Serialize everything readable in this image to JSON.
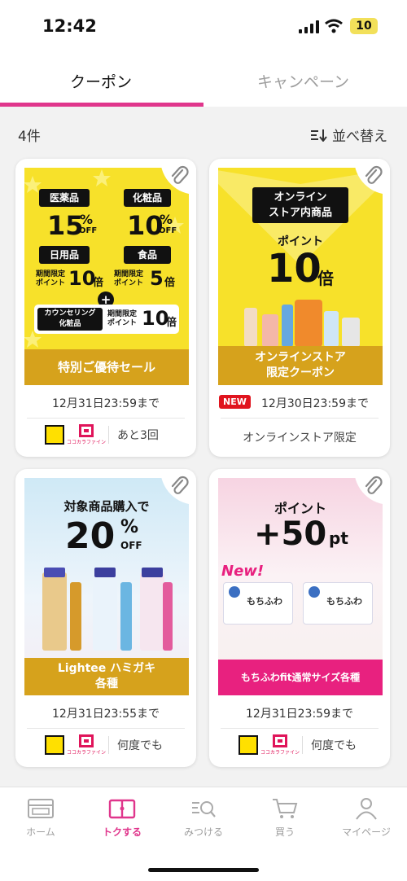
{
  "status_bar": {
    "time": "12:42",
    "battery": "10"
  },
  "tabs": [
    {
      "label": "クーポン",
      "active": true
    },
    {
      "label": "キャンペーン",
      "active": false
    }
  ],
  "list": {
    "count": "4件",
    "sort_label": "並べ替え"
  },
  "coupons": [
    {
      "banner": {
        "cat1": "医薬品",
        "pct1": "15",
        "cat2": "化粧品",
        "pct2": "10",
        "pct_sign": "%",
        "off": "OFF",
        "cat3": "日用品",
        "cat4": "食品",
        "limited1": "期間限定\nポイント",
        "mult1": "10",
        "mult1_unit": "倍",
        "limited2": "期間限定\nポイント",
        "mult2": "5",
        "mult2_unit": "倍",
        "plus": "+",
        "cat5": "カウンセリング\n化粧品",
        "limited3": "期間限定\nポイント",
        "mult3": "10",
        "mult3_unit": "倍",
        "ribbon": "特別ご優待セール"
      },
      "expiry": "12月31日23:59まで",
      "remaining": "あと3回",
      "logo_text": "ココカラファイン"
    },
    {
      "banner": {
        "box": "オンライン\nストア内商品",
        "point_label": "ポイント",
        "big": "10",
        "unit": "倍",
        "ribbon": "オンラインストア\n限定クーポン"
      },
      "new_badge": "NEW",
      "expiry": "12月30日23:59まで",
      "note": "オンラインストア限定"
    },
    {
      "banner": {
        "headline": "対象商品購入で",
        "big": "20",
        "pct": "%",
        "off": "OFF",
        "ribbon": "Lightee ハミガキ\n各種"
      },
      "expiry": "12月31日23:55まで",
      "usage": "何度でも",
      "logo_text": "ココカラファイン"
    },
    {
      "banner": {
        "point_label": "ポイント",
        "big": "+50",
        "unit": "pt",
        "new_script": "New!",
        "product_name": "もちふわ",
        "ribbon": "もちふわfit通常サイズ各種"
      },
      "expiry": "12月31日23:59まで",
      "usage": "何度でも",
      "logo_text": "ココカラファイン"
    }
  ],
  "bottom_nav": [
    {
      "label": "ホーム",
      "icon": "store-icon",
      "active": false
    },
    {
      "label": "トクする",
      "icon": "coupon-book-icon",
      "active": true
    },
    {
      "label": "みつける",
      "icon": "search-list-icon",
      "active": false
    },
    {
      "label": "買う",
      "icon": "cart-icon",
      "active": false
    },
    {
      "label": "マイページ",
      "icon": "person-icon",
      "active": false
    }
  ],
  "colors": {
    "accent": "#e0368c",
    "yellow": "#f7e12a",
    "gold": "#d4a017",
    "pink": "#e8217f"
  }
}
